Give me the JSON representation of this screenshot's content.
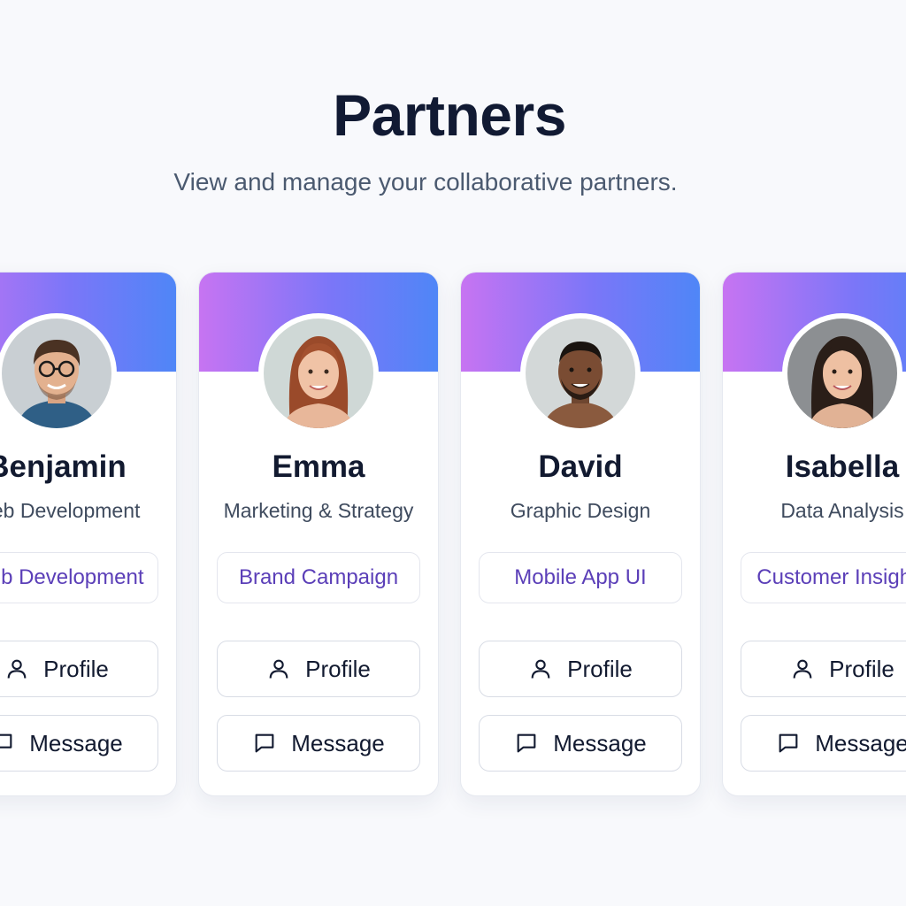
{
  "header": {
    "title": "Partners",
    "subtitle": "View and manage your collaborative partners."
  },
  "colors": {
    "gradient_start": "#c774f2",
    "gradient_end": "#4f86f7",
    "tag_text": "#5b3fb8",
    "title_text": "#111a33"
  },
  "partners": [
    {
      "name": "Benjamin",
      "role": "Web Development",
      "project": "Web Development",
      "profile_label": "Profile",
      "message_label": "Message"
    },
    {
      "name": "Emma",
      "role": "Marketing & Strategy",
      "project": "Brand Campaign",
      "profile_label": "Profile",
      "message_label": "Message"
    },
    {
      "name": "David",
      "role": "Graphic Design",
      "project": "Mobile App UI",
      "profile_label": "Profile",
      "message_label": "Message"
    },
    {
      "name": "Isabella",
      "role": "Data Analysis",
      "project": "Customer Insights",
      "profile_label": "Profile",
      "message_label": "Message"
    }
  ],
  "icons": {
    "profile": "user-icon",
    "message": "chat-bubble-icon"
  }
}
